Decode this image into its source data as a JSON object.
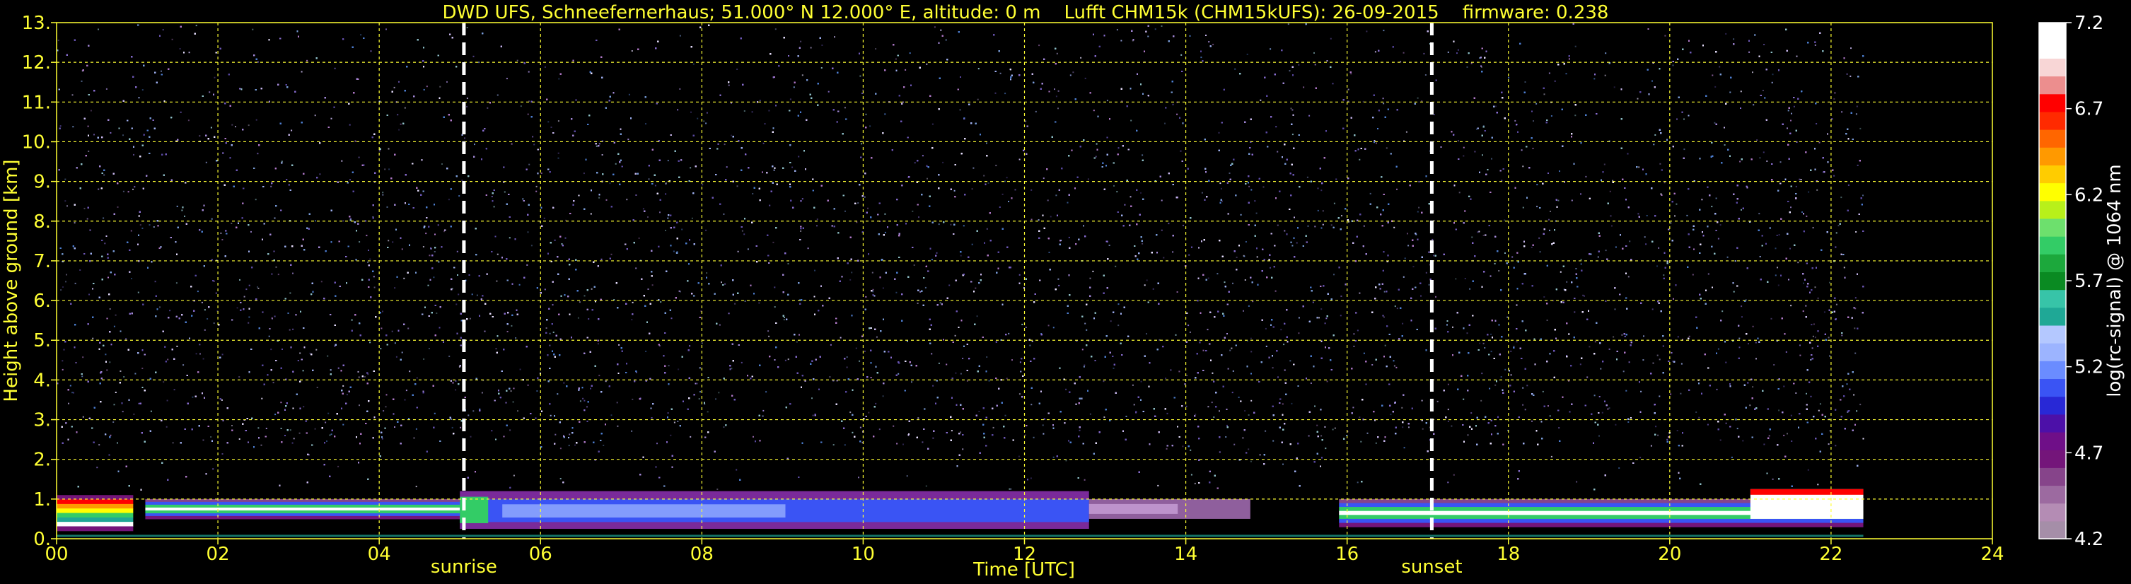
{
  "chart_data": {
    "type": "heatmap",
    "title": "DWD UFS, Schneefernerhaus; 51.000° N 12.000° E, altitude: 0 m    Lufft CHM15k (CHM15kUFS): 26-09-2015    firmware: 0.238",
    "xlabel": "Time [UTC]",
    "ylabel": "Height above ground [km]",
    "xlim": [
      0,
      24
    ],
    "ylim": [
      0,
      13
    ],
    "x_ticks": [
      "00",
      "02",
      "04",
      "06",
      "08",
      "10",
      "12",
      "14",
      "16",
      "18",
      "20",
      "22",
      "24"
    ],
    "y_ticks": [
      "0.",
      "1.",
      "2.",
      "3.",
      "4.",
      "5.",
      "6.",
      "7.",
      "8.",
      "9.",
      "10.",
      "11.",
      "12.",
      "13."
    ],
    "grid": true,
    "data_end_hour": 22.4,
    "markers": [
      {
        "label": "sunrise",
        "hour": 5.05
      },
      {
        "label": "sunset",
        "hour": 17.05
      }
    ],
    "colorbar": {
      "label": "log(rc-signal) @ 1064 nm",
      "min": 4.2,
      "max": 7.2,
      "ticks": [
        "4.2",
        "4.7",
        "5.2",
        "5.7",
        "6.2",
        "6.7",
        "7.2"
      ],
      "colors": [
        "#a58ea8",
        "#b48cb4",
        "#9c6aa0",
        "#86448a",
        "#74157a",
        "#6f0f88",
        "#4c10a8",
        "#2828d6",
        "#3a54f4",
        "#6a8cff",
        "#9cb4ff",
        "#b4c8ff",
        "#1fa896",
        "#37c4a8",
        "#0a8a22",
        "#1ca83c",
        "#33cc66",
        "#6de06d",
        "#b8f01a",
        "#ffff00",
        "#ffcc00",
        "#ff9900",
        "#ff6600",
        "#ff2a00",
        "#ff0000",
        "#ec8e8e",
        "#f8d6d6",
        "#ffffff",
        "#ffffff"
      ]
    },
    "layers": [
      {
        "name": "noise",
        "start": 0.0,
        "end": 22.4,
        "heights": [
          0.0,
          13.0
        ],
        "note": "background noise"
      },
      {
        "name": "boundary-layer",
        "segments": [
          {
            "start": 0.0,
            "end": 0.95,
            "top": 1.1,
            "base": 0.2
          },
          {
            "start": 1.1,
            "end": 5.0,
            "top": 1.0,
            "base": 0.5
          },
          {
            "start": 5.0,
            "end": 12.8,
            "top": 1.2,
            "base": 0.25
          },
          {
            "start": 12.8,
            "end": 14.8,
            "top": 1.0,
            "base": 0.5
          },
          {
            "start": 15.9,
            "end": 22.4,
            "top": 1.0,
            "base": 0.3
          }
        ]
      }
    ]
  }
}
